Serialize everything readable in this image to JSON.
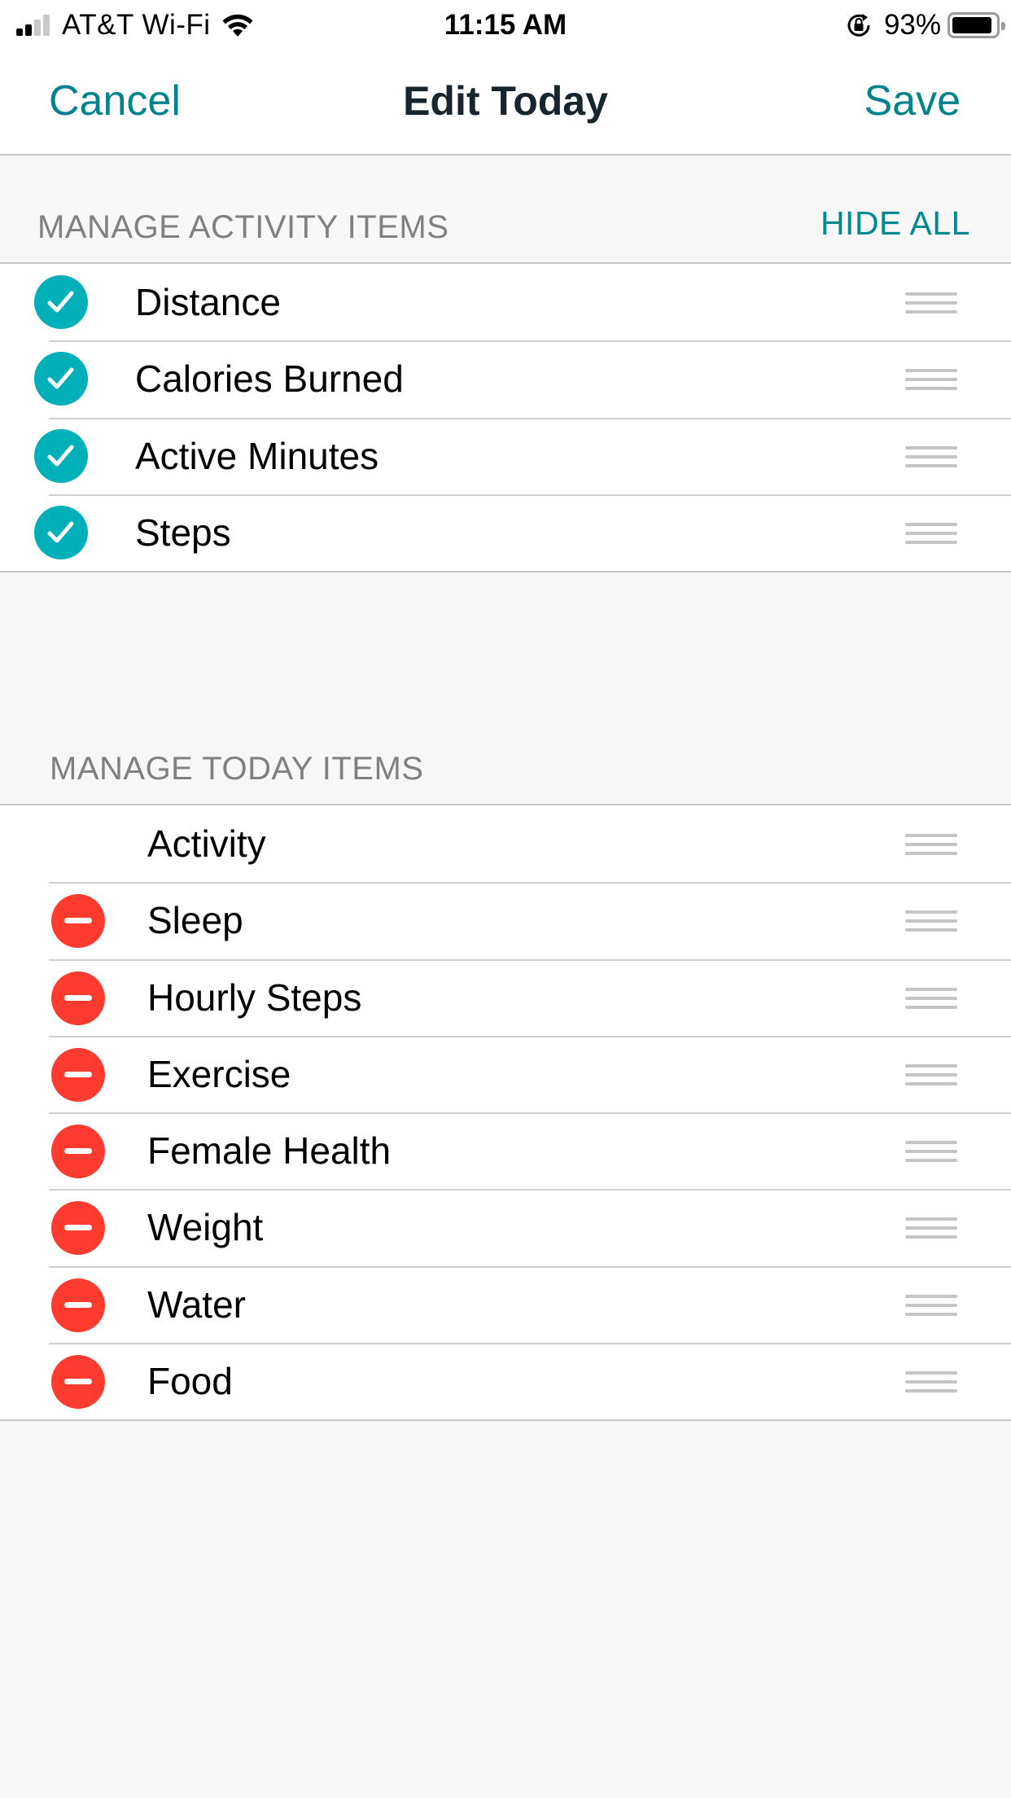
{
  "status_bar": {
    "carrier": "AT&T Wi-Fi",
    "signal_bars_active": 2,
    "signal_bars_total": 4,
    "time": "11:15 AM",
    "battery_percent_label": "93%",
    "battery_level": 0.93,
    "icons": [
      "signal-icon",
      "wifi-icon",
      "rotation-lock-icon",
      "battery-icon"
    ]
  },
  "nav": {
    "cancel_label": "Cancel",
    "title": "Edit Today",
    "save_label": "Save"
  },
  "colors": {
    "accent_teal": "#00838a",
    "check_teal": "#00b0b9",
    "delete_red": "#ff3b30",
    "header_gray": "#808080",
    "background": "#f7f7f7"
  },
  "activity_section": {
    "title": "MANAGE ACTIVITY ITEMS",
    "action_label": "HIDE ALL",
    "items": [
      {
        "label": "Distance",
        "checked": true
      },
      {
        "label": "Calories Burned",
        "checked": true
      },
      {
        "label": "Active Minutes",
        "checked": true
      },
      {
        "label": "Steps",
        "checked": true
      }
    ]
  },
  "today_section": {
    "title": "MANAGE TODAY ITEMS",
    "items": [
      {
        "label": "Activity",
        "removable": false
      },
      {
        "label": "Sleep",
        "removable": true
      },
      {
        "label": "Hourly Steps",
        "removable": true
      },
      {
        "label": "Exercise",
        "removable": true
      },
      {
        "label": "Female Health",
        "removable": true
      },
      {
        "label": "Weight",
        "removable": true
      },
      {
        "label": "Water",
        "removable": true
      },
      {
        "label": "Food",
        "removable": true
      }
    ]
  }
}
